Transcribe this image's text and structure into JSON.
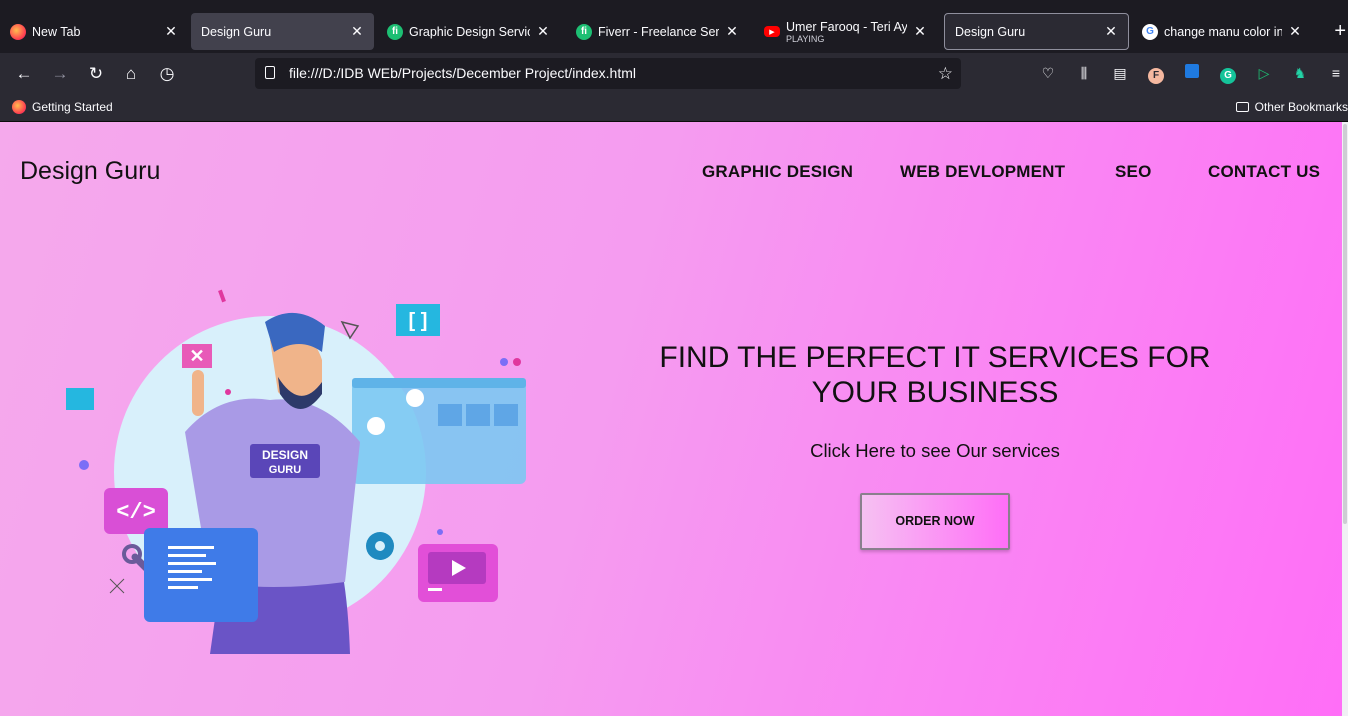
{
  "browser": {
    "tabs": [
      {
        "title": "New Tab",
        "icon": "firefox-icon"
      },
      {
        "title": "Design Guru",
        "icon": "none"
      },
      {
        "title": "Graphic Design Services - ",
        "icon": "fiverr-icon"
      },
      {
        "title": "Fiverr - Freelance Services",
        "icon": "fiverr-icon"
      },
      {
        "title": "Umer Farooq - Teri Ay (O",
        "subtitle": "PLAYING",
        "icon": "youtube-icon"
      },
      {
        "title": "Design Guru",
        "icon": "none"
      },
      {
        "title": "change manu color in cs",
        "icon": "google-icon"
      }
    ],
    "new_tab_label": "+",
    "url": "file:///D:/IDB WEb/Projects/December Project/index.html",
    "bookmarks": {
      "left": "Getting Started",
      "right": "Other Bookmarks"
    }
  },
  "site": {
    "brand": "Design Guru",
    "menu": [
      "GRAPHIC DESIGN",
      "WEB DEVLOPMENT",
      "SEO",
      "CONTACT US"
    ],
    "hero_title": "FIND THE PERFECT IT SERVICES FOR YOUR BUSINESS",
    "hero_subtitle": "Click Here to see Our services",
    "order_button": "ORDER NOW",
    "illustration": {
      "shirt_line1": "DESIGN",
      "shirt_line2": "GURU",
      "code_tag": "</>",
      "bracket_tag": "[ ]"
    }
  },
  "colors": {
    "page_gradient_start": "#f5a9ec",
    "page_gradient_end": "#ff6ef7",
    "chrome_dark": "#1c1b22",
    "chrome": "#2b2a33"
  }
}
